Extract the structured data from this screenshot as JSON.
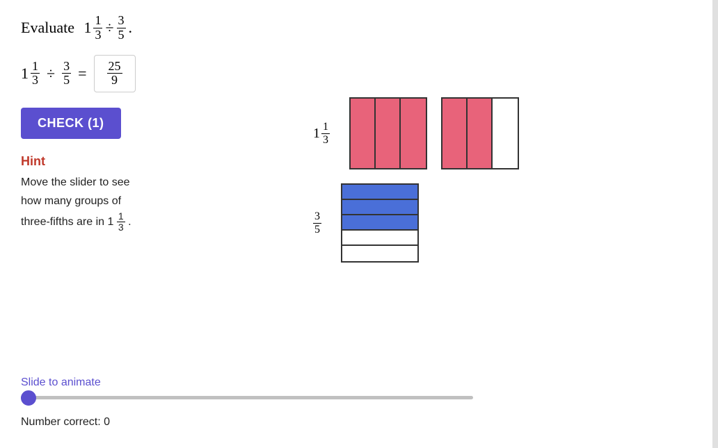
{
  "title": {
    "text": "Evaluate",
    "mixed_whole": "1",
    "mixed_num": "1",
    "mixed_den": "3",
    "div_symbol": "÷",
    "frac_num": "3",
    "frac_den": "5",
    "period": "."
  },
  "equation": {
    "whole": "1",
    "num1": "1",
    "den1": "3",
    "div": "÷",
    "num2": "3",
    "den2": "5",
    "equals": "=",
    "answer_num": "25",
    "answer_den": "9"
  },
  "check_button": {
    "label": "CHECK (1)"
  },
  "hint": {
    "title": "Hint",
    "line1": "Move the slider to see",
    "line2": "how many groups of",
    "line3_pre": "three-fifths are in 1",
    "line3_frac_num": "1",
    "line3_frac_den": "3",
    "line3_post": "."
  },
  "diagrams": {
    "top_label_whole": "1",
    "top_label_frac_num": "1",
    "top_label_frac_den": "3",
    "bottom_label_frac_num": "3",
    "bottom_label_frac_den": "5",
    "rect1_cells": [
      "pink",
      "pink",
      "pink"
    ],
    "rect2_cells": [
      "pink",
      "pink",
      "white"
    ],
    "horiz_cells": [
      "blue",
      "blue",
      "blue",
      "white",
      "white"
    ]
  },
  "slider": {
    "label": "Slide to animate",
    "min": 0,
    "max": 100,
    "value": 0
  },
  "footer": {
    "number_correct_label": "Number correct: 0"
  },
  "colors": {
    "accent": "#5b4fcf",
    "hint": "#c0392b",
    "pink": "#e8637a",
    "blue": "#4a6fd8"
  }
}
